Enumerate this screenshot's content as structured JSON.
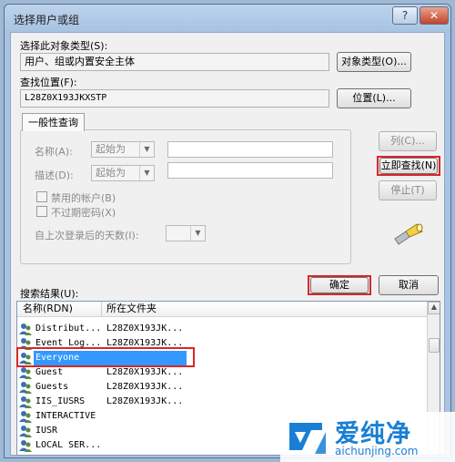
{
  "window": {
    "title": "选择用户或组",
    "help": "?",
    "close": "✕"
  },
  "object_type": {
    "label": "选择此对象类型(S):",
    "value": "用户、组或内置安全主体",
    "button": "对象类型(O)..."
  },
  "location": {
    "label": "查找位置(F):",
    "value": "L28Z0X193JKXSTP",
    "button": "位置(L)..."
  },
  "query": {
    "tab": "一般性查询",
    "name_label": "名称(A):",
    "name_mode": "起始为",
    "desc_label": "描述(D):",
    "desc_mode": "起始为",
    "disabled_accounts": "禁用的帐户(B)",
    "non_expiring": "不过期密码(X)",
    "days_label": "自上次登录后的天数(I):"
  },
  "side_buttons": {
    "columns": "列(C)...",
    "find_now": "立即查找(N)",
    "stop": "停止(T)"
  },
  "actions": {
    "ok": "确定",
    "cancel": "取消"
  },
  "results": {
    "label": "搜索结果(U):",
    "col_name": "名称(RDN)",
    "col_folder": "所在文件夹",
    "rows": [
      {
        "name": "Distribut...",
        "folder": "L28Z0X193JK..."
      },
      {
        "name": "Event Log...",
        "folder": "L28Z0X193JK..."
      },
      {
        "name": "Everyone",
        "folder": ""
      },
      {
        "name": "Guest",
        "folder": "L28Z0X193JK..."
      },
      {
        "name": "Guests",
        "folder": "L28Z0X193JK..."
      },
      {
        "name": "IIS_IUSRS",
        "folder": "L28Z0X193JK..."
      },
      {
        "name": "INTERACTIVE",
        "folder": ""
      },
      {
        "name": "IUSR",
        "folder": ""
      },
      {
        "name": "LOCAL SER...",
        "folder": ""
      }
    ]
  },
  "watermark": {
    "brand": "爱纯净",
    "url": "aichunjing.com"
  },
  "colors": {
    "accent_red": "#d8262a",
    "selection": "#3399ff",
    "brand_blue": "#1a7fd4"
  }
}
